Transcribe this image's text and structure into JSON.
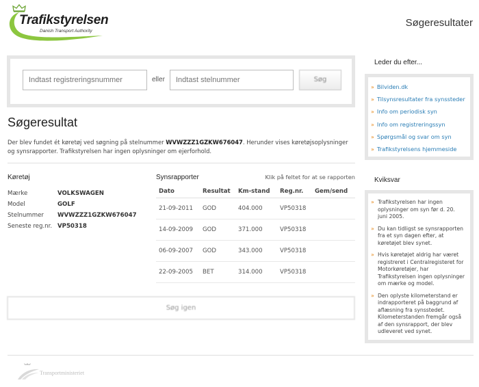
{
  "brand": {
    "name": "Trafikstyrelsen",
    "subtitle": "Danish Transport Authority",
    "accent": "#8cc63f"
  },
  "header": {
    "title": "Søgeresultater"
  },
  "search": {
    "reg_placeholder": "Indtast registreringsnummer",
    "separator": "eller",
    "stel_placeholder": "Indtast stelnummer",
    "submit_label": "Søg"
  },
  "result": {
    "title": "Søgeresultat",
    "intro_before": "Der blev fundet ét køretøj ved søgning på stelnummer ",
    "vin": "WVWZZZ1GZKW676047",
    "intro_after": ". Herunder vises køretøjsoplysninger og synsrapporter. Trafikstyrelsen har ingen oplysninger om ejerforhold."
  },
  "vehicle": {
    "section_title": "Køretøj",
    "rows": [
      {
        "label": "Mærke",
        "value": "VOLKSWAGEN"
      },
      {
        "label": "Model",
        "value": "GOLF"
      },
      {
        "label": "Stelnummer",
        "value": "WVWZZZ1GZKW676047"
      },
      {
        "label": "Seneste reg.nr.",
        "value": "VP50318"
      }
    ]
  },
  "reports": {
    "section_title": "Synsrapporter",
    "hint": "Klik på feltet for at se rapporten",
    "columns": [
      "Dato",
      "Resultat",
      "Km-stand",
      "Reg.nr.",
      "Gem/send"
    ],
    "rows": [
      {
        "date": "21-09-2011",
        "result": "GOD",
        "km": "404.000",
        "reg": "VP50318",
        "save": ""
      },
      {
        "date": "14-09-2009",
        "result": "GOD",
        "km": "371.000",
        "reg": "VP50318",
        "save": ""
      },
      {
        "date": "06-09-2007",
        "result": "GOD",
        "km": "343.000",
        "reg": "VP50318",
        "save": ""
      },
      {
        "date": "22-09-2005",
        "result": "BET",
        "km": "314.000",
        "reg": "VP50318",
        "save": ""
      }
    ]
  },
  "search_again_label": "Søg igen",
  "sidebar": {
    "links_title": "Leder du efter...",
    "links": [
      "Bilviden.dk",
      "Tilsynsresultater fra synssteder",
      "Info om periodisk syn",
      "Info om registreringssyn",
      "Spørgsmål og svar om syn",
      "Trafikstyrelsens hjemmeside"
    ],
    "kviksvar_title": "Kviksvar",
    "kviksvar": [
      "Trafikstyrelsen har ingen oplysninger om syn før d. 20. juni 2005.",
      "Du kan tidligst se synsrapporten fra et syn dagen efter, at køretøjet blev synet.",
      "Hvis køretøjet aldrig har været registreret i Centralregisteret for Motorkøretøjer, har Trafikstyrelsen ingen oplysninger om mærke og model.",
      "Den oplyste kilometerstand er indrapporteret på baggrund af aflæsning fra synsstedet. Kilometerstanden fremgår også af den synsrapport, der blev udleveret ved synet."
    ]
  },
  "footer": {
    "ministry": "Transportministeriet"
  }
}
